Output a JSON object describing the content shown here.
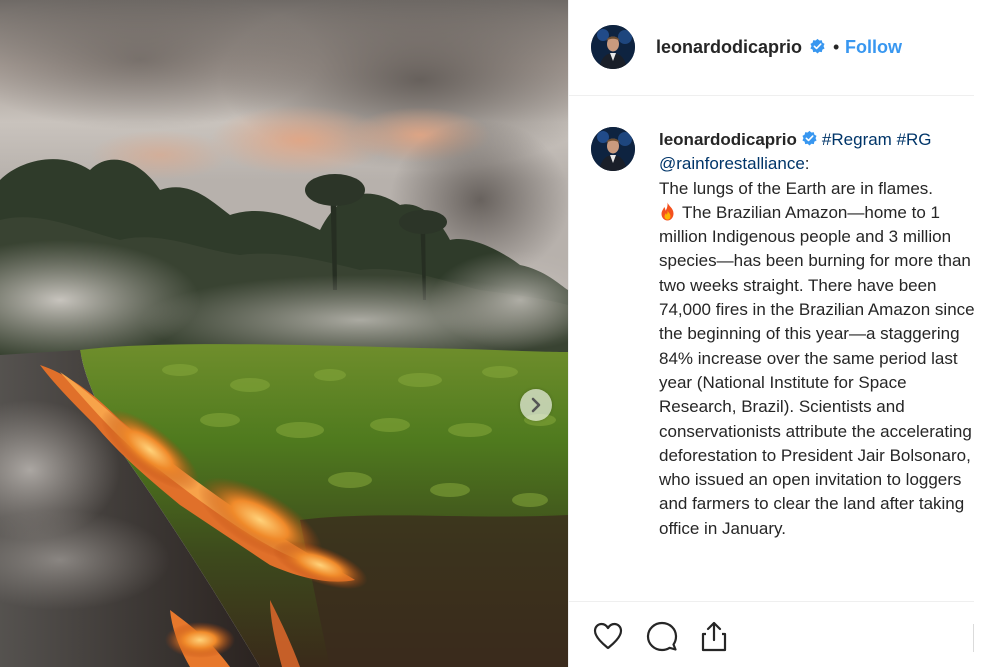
{
  "post": {
    "photo": {
      "description_icon": "photo",
      "next_icon": "chevron-right-icon"
    },
    "header": {
      "username": "leonardodicaprio",
      "separator": "•",
      "follow_label": "Follow"
    },
    "caption": {
      "username": "leonardodicaprio",
      "hashtag1": "#Regram",
      "hashtag2": "#RG",
      "mention": "@rainforestalliance",
      "mention_suffix": ":",
      "line1": "The lungs of the Earth are in flames.",
      "body": "The Brazilian Amazon—home to 1 million Indigenous people and 3 million species—has been burning for more than two weeks straight. There have been 74,000 fires in the Brazilian Amazon since the beginning of this year—a staggering 84% increase over the same period last year (National Institute for Space Research, Brazil). Scientists and conservationists attribute the accelerating deforestation to President Jair Bolsonaro, who issued an open invitation to loggers and farmers to clear the land after taking office in January."
    },
    "actions": {
      "like_icon": "heart-icon",
      "comment_icon": "comment-icon",
      "share_icon": "share-icon"
    }
  },
  "colors": {
    "link_blue": "#3897f0",
    "hashtag_blue": "#003569",
    "verified_blue": "#3897f0",
    "text": "#262626",
    "divider": "#efefef"
  }
}
